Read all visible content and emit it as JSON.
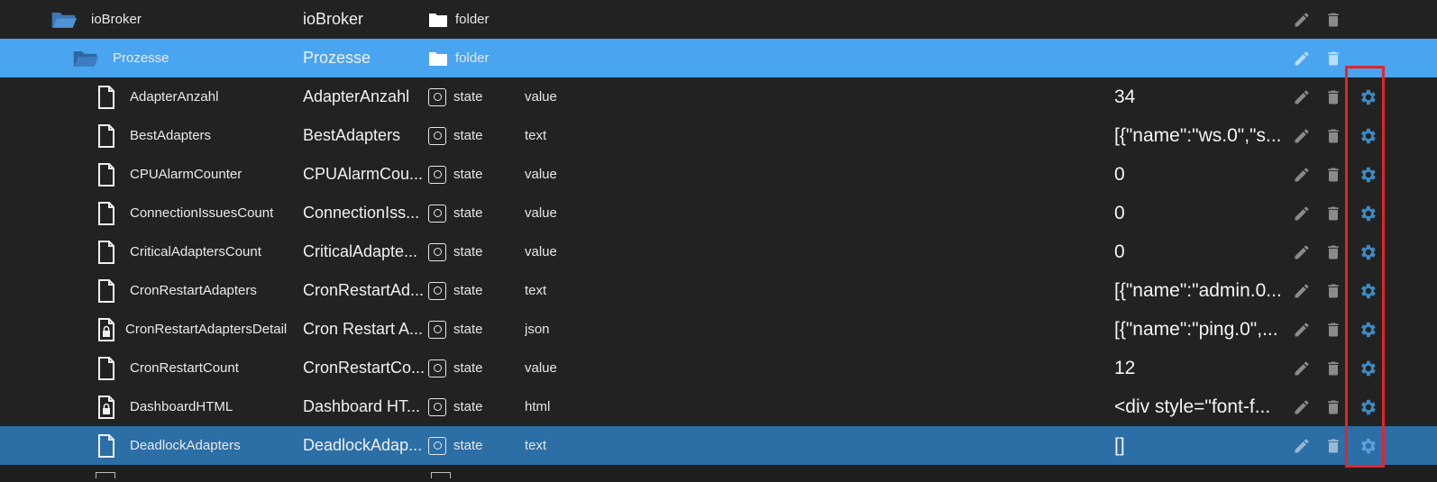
{
  "colors": {
    "background": "#222222",
    "highlight_row": "#4aa5f0",
    "selected_row": "#2c6ea6",
    "gear_icon": "#3c8ac4",
    "action_icon": "#8a8a8a",
    "outline": "#e0262b"
  },
  "rows": [
    {
      "id": "ioBroker",
      "name": "ioBroker",
      "type": "folder",
      "role": "",
      "value": "",
      "icon": "folder-open-icon"
    },
    {
      "id": "Prozesse",
      "name": "Prozesse",
      "type": "folder",
      "role": "",
      "value": "",
      "icon": "folder-open-icon"
    },
    {
      "id": "AdapterAnzahl",
      "name": "AdapterAnzahl",
      "type": "state",
      "role": "value",
      "value": "34",
      "icon": "file-icon"
    },
    {
      "id": "BestAdapters",
      "name": "BestAdapters",
      "type": "state",
      "role": "text",
      "value": "[{\"name\":\"ws.0\",\"s...",
      "icon": "file-icon"
    },
    {
      "id": "CPUAlarmCounter",
      "name": "CPUAlarmCou...",
      "type": "state",
      "role": "value",
      "value": "0",
      "icon": "file-icon"
    },
    {
      "id": "ConnectionIssuesCount",
      "name": "ConnectionIss...",
      "type": "state",
      "role": "value",
      "value": "0",
      "icon": "file-icon"
    },
    {
      "id": "CriticalAdaptersCount",
      "name": "CriticalAdapte...",
      "type": "state",
      "role": "value",
      "value": "0",
      "icon": "file-icon"
    },
    {
      "id": "CronRestartAdapters",
      "name": "CronRestartAd...",
      "type": "state",
      "role": "text",
      "value": "[{\"name\":\"admin.0...",
      "icon": "file-icon"
    },
    {
      "id": "CronRestartAdaptersDetail",
      "name": "Cron Restart A...",
      "type": "state",
      "role": "json",
      "value": "[{\"name\":\"ping.0\",...",
      "icon": "file-lock-icon"
    },
    {
      "id": "CronRestartCount",
      "name": "CronRestartCo...",
      "type": "state",
      "role": "value",
      "value": "12",
      "icon": "file-icon"
    },
    {
      "id": "DashboardHTML",
      "name": "Dashboard HT...",
      "type": "state",
      "role": "html",
      "value": "<div style=\"font-f...",
      "icon": "file-lock-icon"
    },
    {
      "id": "DeadlockAdapters",
      "name": "DeadlockAdap...",
      "type": "state",
      "role": "text",
      "value": "[]",
      "icon": "file-icon"
    }
  ]
}
